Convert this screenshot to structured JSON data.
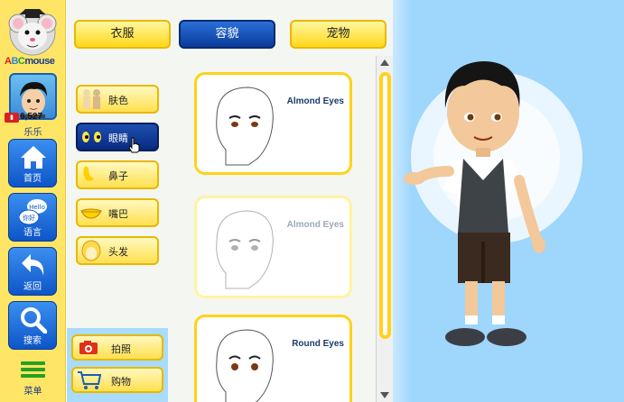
{
  "brand": {
    "logo_text_a": "A",
    "logo_text_b": "B",
    "logo_text_c": "C",
    "logo_text_rest": "mouse"
  },
  "user": {
    "tickets": "6,527",
    "name": "乐乐"
  },
  "nav": [
    {
      "label": "首页",
      "icon": "home-icon"
    },
    {
      "label": "语言",
      "icon": "language-icon",
      "bubble1": "Hello",
      "bubble2": "你好"
    },
    {
      "label": "返回",
      "icon": "back-arrow-icon"
    },
    {
      "label": "搜索",
      "icon": "magnifier-icon"
    },
    {
      "label": "菜单",
      "icon": "menu-icon"
    }
  ],
  "tabs": [
    {
      "label": "衣服",
      "active": false
    },
    {
      "label": "容貌",
      "active": true
    },
    {
      "label": "宠物",
      "active": false
    }
  ],
  "categories": [
    {
      "label": "肤色",
      "icon": "skin-tone-icon",
      "active": false
    },
    {
      "label": "眼睛",
      "icon": "eyes-icon",
      "active": true
    },
    {
      "label": "鼻子",
      "icon": "nose-icon",
      "active": false
    },
    {
      "label": "嘴巴",
      "icon": "mouth-icon",
      "active": false
    },
    {
      "label": "头发",
      "icon": "hair-icon",
      "active": false
    }
  ],
  "actions": [
    {
      "label": "拍照",
      "icon": "camera-icon"
    },
    {
      "label": "购物",
      "icon": "shopping-cart-icon"
    }
  ],
  "options": [
    {
      "name": "Almond Eyes",
      "state": "selected"
    },
    {
      "name": "Almond Eyes",
      "state": "dimmed"
    },
    {
      "name": "Round Eyes",
      "state": "normal"
    }
  ],
  "colors": {
    "nav_bg": "#ffe566",
    "nav_button": "#0d55c8",
    "tab_active": "#0a3b9a",
    "button_yellow": "#ffd81a",
    "stage_bg": "#9fd6fb"
  }
}
